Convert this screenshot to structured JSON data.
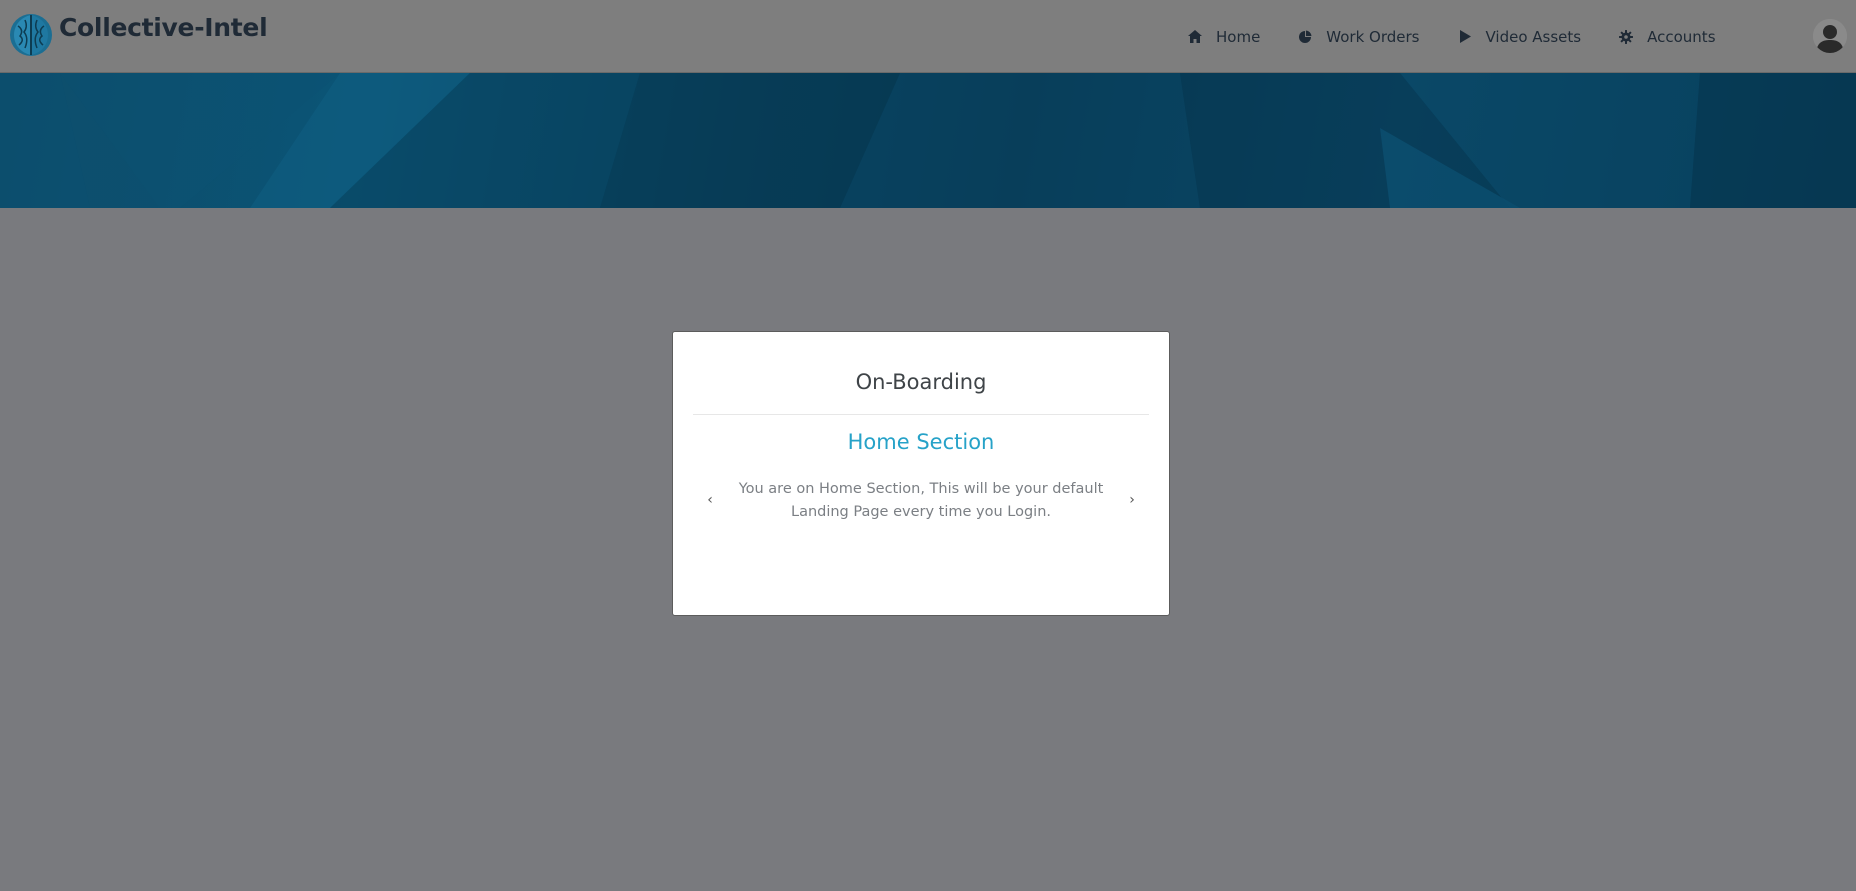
{
  "header": {
    "brand": "Collective-Intel",
    "logo_icon": "brain-globe-icon",
    "nav": [
      {
        "label": "Home",
        "icon": "home-icon"
      },
      {
        "label": "Work Orders",
        "icon": "pie-chart-icon"
      },
      {
        "label": "Video Assets",
        "icon": "play-icon"
      },
      {
        "label": "Accounts",
        "icon": "gear-icon"
      }
    ],
    "avatar_icon": "user-avatar-icon"
  },
  "modal": {
    "title": "On-Boarding",
    "section_title": "Home Section",
    "section_text": "You are on Home Section, This will be your default Landing Page every time you Login.",
    "prev_arrow": "‹",
    "next_arrow": "›"
  },
  "colors": {
    "overlay": "#797a7e",
    "banner": "#0b4a68",
    "accent": "#26a2c8"
  }
}
